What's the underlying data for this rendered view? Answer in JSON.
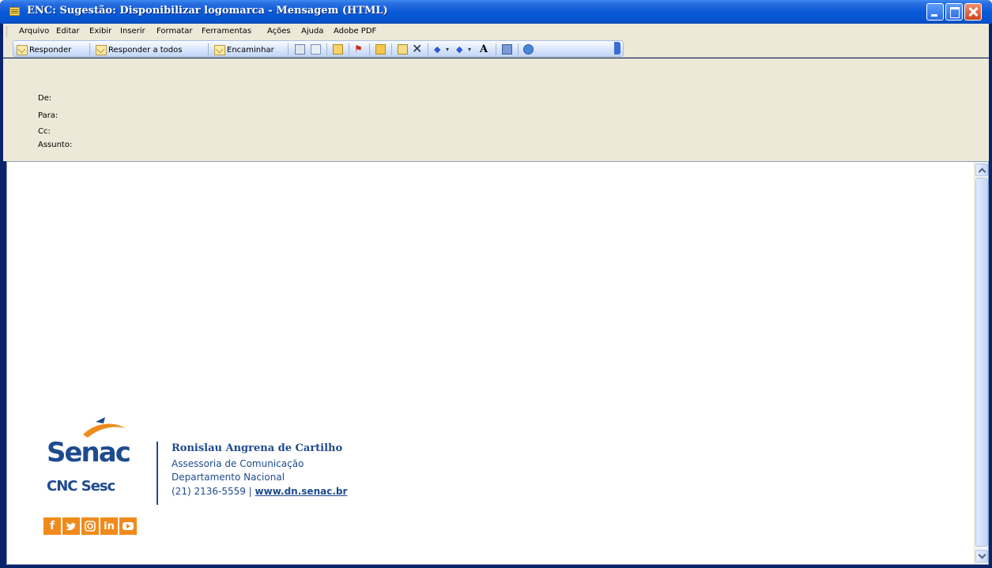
{
  "window": {
    "title": "ENC: Sugestão: Disponibilizar logomarca - Mensagem (HTML)"
  },
  "menu": [
    "Arquivo",
    "Editar",
    "Exibir",
    "Inserir",
    "Formatar",
    "Ferramentas",
    "Ações",
    "Ajuda",
    "Adobe PDF"
  ],
  "toolbar": {
    "reply": "Responder",
    "reply_all": "Responder a todos",
    "forward": "Encaminhar",
    "font_size": "A"
  },
  "header": {
    "from_label": "De:",
    "to_label": "Para:",
    "cc_label": "Cc:",
    "subject_label": "Assunto:"
  },
  "signature": {
    "logo": "Senac",
    "sub_logos": "CNC  Sesc",
    "name": "Ronislau Angrena de Cartilho",
    "role": "Assessoria de Comunicação",
    "department": "Departamento Nacional",
    "phone": "(21) 2136-5559 |",
    "website": "www.dn.senac.br",
    "social": [
      "f",
      "t",
      "ig",
      "in",
      "yt"
    ]
  },
  "colors": {
    "brand_blue": "#1e4b8f",
    "brand_orange": "#f08a1c"
  }
}
